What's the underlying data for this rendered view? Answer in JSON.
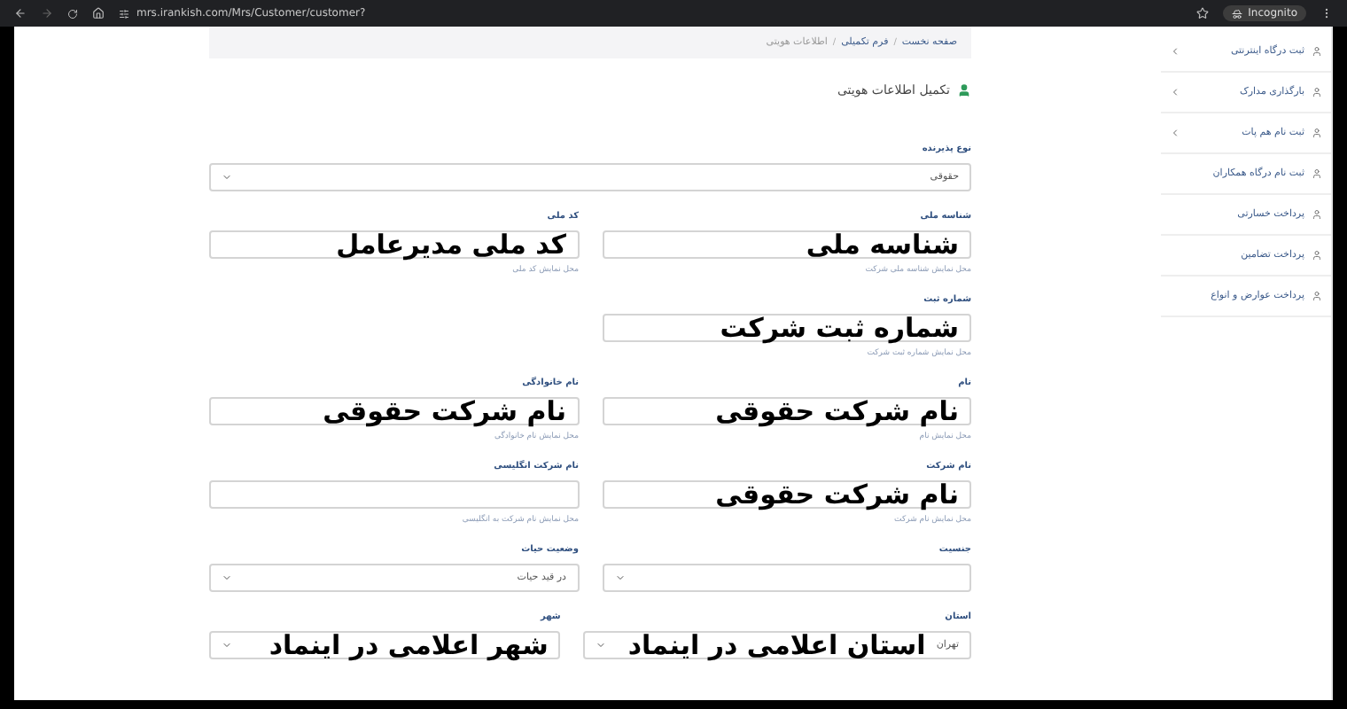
{
  "browser": {
    "url": "mrs.irankish.com/Mrs/Customer/customer?",
    "profile": "Incognito"
  },
  "breadcrumb": {
    "separator": "/",
    "items": [
      "صفحه نخست",
      "فرم تکمیلی",
      "اطلاعات هویتی"
    ]
  },
  "heading": "تکمیل اطلاعات هویتی",
  "form": {
    "rows": [
      {
        "fields": [
          {
            "kind": "select",
            "wide": true,
            "label": "نوع پذیرنده",
            "value": "حقوقی"
          }
        ]
      },
      {
        "fields": [
          {
            "kind": "input",
            "label": "شناسه ملی",
            "annotation": "شناسه ملی",
            "hint": "محل نمایش شناسه ملی شرکت"
          },
          {
            "kind": "input",
            "label": "کد ملی",
            "annotation": "کد ملی مدیرعامل",
            "hint": "محل نمایش کد ملی"
          }
        ]
      },
      {
        "fields": [
          {
            "kind": "input",
            "label": "شماره ثبت",
            "annotation": "شماره ثبت شرکت",
            "hint": "محل نمایش شماره ثبت شرکت"
          }
        ]
      },
      {
        "fields": [
          {
            "kind": "input",
            "label": "نام",
            "annotation": "نام شرکت حقوقی",
            "hint": "محل نمایش نام"
          },
          {
            "kind": "input",
            "label": "نام خانوادگی",
            "annotation": "نام شرکت حقوقی",
            "hint": "محل نمایش نام خانوادگی"
          }
        ]
      },
      {
        "fields": [
          {
            "kind": "input",
            "label": "نام شرکت",
            "annotation": "نام شرکت حقوقی",
            "hint": "محل نمایش نام شرکت"
          },
          {
            "kind": "input",
            "label": "نام شرکت انگلیسی",
            "hint": "محل نمایش نام شرکت به انگلیسی"
          }
        ]
      },
      {
        "fields": [
          {
            "kind": "select",
            "label": "جنسیت"
          },
          {
            "kind": "select",
            "label": "وضعیت حیات",
            "value": "در قید حیات"
          }
        ]
      },
      {
        "fields": [
          {
            "kind": "select",
            "label": "استان",
            "value": "تهران",
            "annotation": "استان اعلامی در اینماد"
          },
          {
            "kind": "select",
            "label": "شهر",
            "annotation": "شهر اعلامی در اینماد"
          }
        ]
      }
    ]
  },
  "sidebar": {
    "items": [
      {
        "label": "ثبت درگاه اینترنتی",
        "expandable": true
      },
      {
        "label": "بارگذاری مدارک",
        "expandable": true
      },
      {
        "label": "ثبت نام هم پات",
        "expandable": true
      },
      {
        "label": "ثبت نام درگاه همکاران",
        "expandable": false
      },
      {
        "label": "پرداخت خسارتی",
        "expandable": false
      },
      {
        "label": "پرداخت تضامین",
        "expandable": false
      },
      {
        "label": "پرداخت عوارض و انواع",
        "expandable": false
      }
    ]
  }
}
